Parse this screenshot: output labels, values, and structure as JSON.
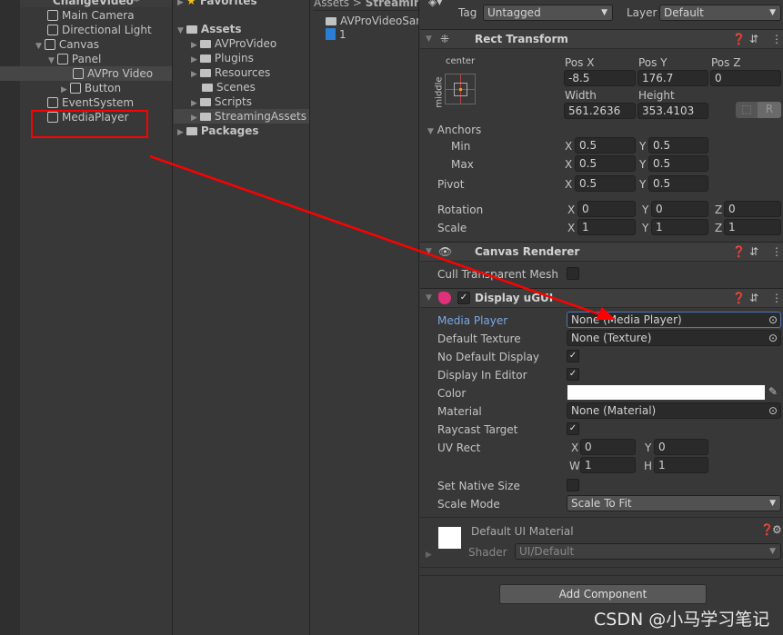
{
  "hierarchy": {
    "scene": "ChangeVideo*",
    "items": [
      {
        "label": "Main Camera",
        "indent": 1
      },
      {
        "label": "Directional Light",
        "indent": 1
      },
      {
        "label": "Canvas",
        "indent": 1,
        "expanded": true
      },
      {
        "label": "Panel",
        "indent": 2,
        "expanded": true
      },
      {
        "label": "AVPro Video",
        "indent": 3,
        "selected": true
      },
      {
        "label": "Button",
        "indent": 3,
        "collapsed": true
      },
      {
        "label": "EventSystem",
        "indent": 1
      },
      {
        "label": "MediaPlayer",
        "indent": 1,
        "highlighted": true
      }
    ]
  },
  "project": {
    "favorites": "Favorites",
    "assets": "Assets",
    "folders": [
      "AVProVideo",
      "Plugins",
      "Resources",
      "Scenes",
      "Scripts",
      "StreamingAssets"
    ],
    "packages": "Packages"
  },
  "browser": {
    "breadcrumb": [
      "Assets",
      "Streaming"
    ],
    "items": [
      "AVProVideoSar",
      "1"
    ]
  },
  "inspector": {
    "tag_label": "Tag",
    "tag": "Untagged",
    "layer_label": "Layer",
    "layer": "Default",
    "rect": {
      "title": "Rect Transform",
      "anchor_h": "center",
      "anchor_v": "middle",
      "posx_l": "Pos X",
      "posy_l": "Pos Y",
      "posz_l": "Pos Z",
      "posx": "-8.5",
      "posy": "176.7",
      "posz": "0",
      "width_l": "Width",
      "height_l": "Height",
      "width": "561.2636",
      "height": "353.4103",
      "r_btn": "R",
      "anchors": "Anchors",
      "min": "Min",
      "max": "Max",
      "pivot": "Pivot",
      "rotation": "Rotation",
      "scale": "Scale",
      "min_x": "0.5",
      "min_y": "0.5",
      "max_x": "0.5",
      "max_y": "0.5",
      "pivot_x": "0.5",
      "pivot_y": "0.5",
      "rot_x": "0",
      "rot_y": "0",
      "rot_z": "0",
      "scale_x": "1",
      "scale_y": "1",
      "scale_z": "1"
    },
    "canvas": {
      "title": "Canvas Renderer",
      "cull": "Cull Transparent Mesh",
      "cull_checked": false
    },
    "display": {
      "title": "Display uGUI",
      "enabled": true,
      "media_player_l": "Media Player",
      "media_player": "None (Media Player)",
      "default_texture_l": "Default Texture",
      "default_texture": "None (Texture)",
      "no_default_l": "No Default Display",
      "no_default": true,
      "display_editor_l": "Display In Editor",
      "display_editor": true,
      "color_l": "Color",
      "color": "#ffffff",
      "material_l": "Material",
      "material": "None (Material)",
      "raycast_l": "Raycast Target",
      "raycast": true,
      "uv_l": "UV Rect",
      "uv_x": "0",
      "uv_y": "0",
      "uv_w": "1",
      "uv_h": "1",
      "native_l": "Set Native Size",
      "native": false,
      "scale_mode_l": "Scale Mode",
      "scale_mode": "Scale To Fit"
    },
    "material": {
      "name": "Default UI Material",
      "shader_l": "Shader",
      "shader": "UI/Default"
    },
    "add_component": "Add Component"
  },
  "axis_labels": {
    "x": "X",
    "y": "Y",
    "z": "Z",
    "w": "W",
    "h": "H"
  },
  "watermark": "CSDN @小马学习笔记",
  "colors": {
    "annotation": "#ff0000",
    "accent": "#7ba8e6"
  }
}
